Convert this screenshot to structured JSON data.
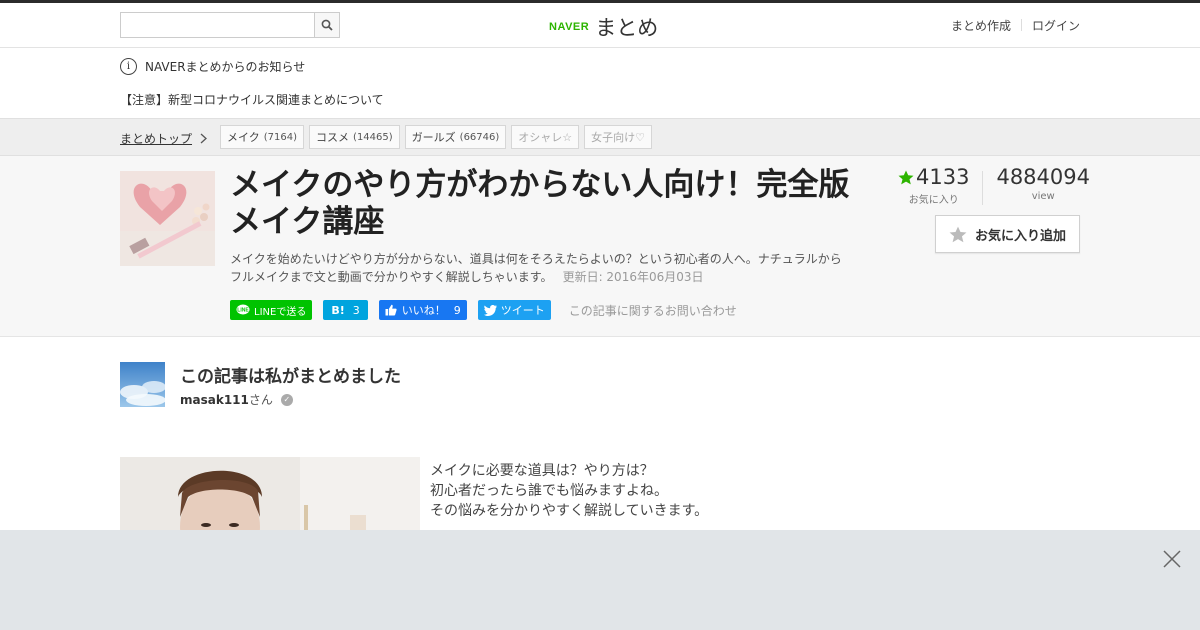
{
  "search": {
    "placeholder": ""
  },
  "logo": {
    "naver": "NAVER",
    "matome": "まとめ"
  },
  "header_nav": {
    "create": "まとめ作成",
    "login": "ログイン"
  },
  "notice": {
    "title": "NAVERまとめからのお知らせ",
    "item": "【注意】新型コロナウイルス関連まとめについて"
  },
  "breadcrumb": {
    "top": "まとめトップ"
  },
  "tags": [
    {
      "label": "メイク",
      "count": "(7164)"
    },
    {
      "label": "コスメ",
      "count": "(14465)"
    },
    {
      "label": "ガールズ",
      "count": "(66746)"
    },
    {
      "label": "オシャレ☆",
      "count": ""
    },
    {
      "label": "女子向け♡",
      "count": ""
    }
  ],
  "article": {
    "title": "メイクのやり方がわからない人向け！完全版メイク講座",
    "description": "メイクを始めたいけどやり方が分からない、道具は何をそろえたらよいの？という初心者の人へ。ナチュラルからフルメイクまで文と動画で分かりやすく解説しちゃいます。",
    "updated": "更新日: 2016年06月03日",
    "favorites": "4133",
    "favorites_label": "お気に入り",
    "views": "4884094",
    "views_label": "view",
    "fav_button": "お気に入り追加"
  },
  "share": {
    "line": "LINEで送る",
    "hatena_icon": "B!",
    "hatena_count": "3",
    "fb": "いいね！",
    "fb_count": "9",
    "tweet": "ツイート",
    "contact": "この記事に関するお問い合わせ"
  },
  "author": {
    "heading": "この記事は私がまとめました",
    "name": "masak111",
    "suffix": "さん"
  },
  "body": {
    "lines": [
      "メイクに必要な道具は？やり方は？",
      "初心者だったら誰でも悩みますよね。",
      "その悩みを分かりやすく解説していきます。"
    ]
  },
  "colors": {
    "accent": "#2db400",
    "line": "#00c300",
    "hatena": "#00a4de",
    "facebook": "#1877f2",
    "twitter": "#1da1f2",
    "overlay": "#e1e5e8"
  },
  "icons": [
    "search-icon",
    "info-icon",
    "chevron-right-icon",
    "star-icon",
    "line-icon",
    "thumbs-up-icon",
    "twitter-bird-icon",
    "verified-check-icon",
    "close-icon"
  ]
}
